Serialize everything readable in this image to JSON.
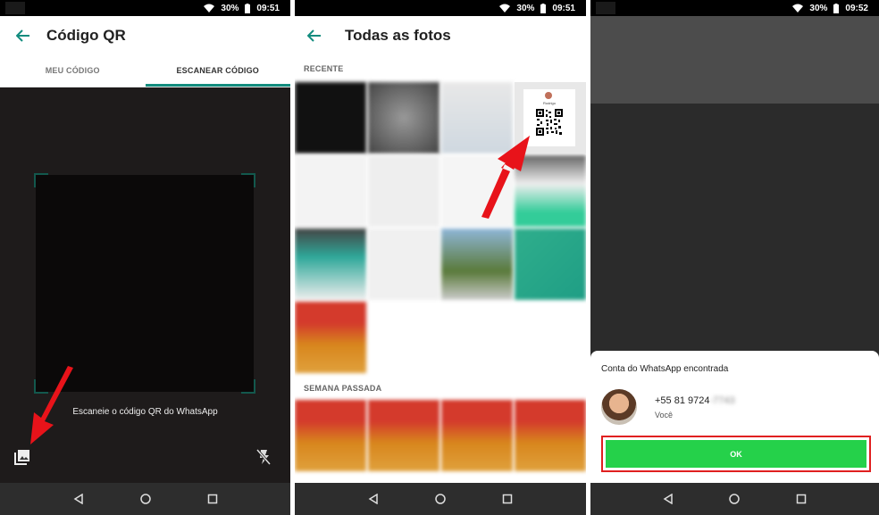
{
  "status": {
    "battery": "30%",
    "times": [
      "09:51",
      "09:51",
      "09:52"
    ]
  },
  "panel1": {
    "title": "Código QR",
    "tabs": [
      "MEU CÓDIGO",
      "ESCANEAR CÓDIGO"
    ],
    "active_tab": 1,
    "hint": "Escaneie o código QR do WhatsApp"
  },
  "panel2": {
    "title": "Todas as fotos",
    "section_recent": "RECENTE",
    "section_last_week": "SEMANA PASSADA",
    "qr_name": "Rodrigo"
  },
  "panel3": {
    "sheet_title": "Conta do WhatsApp encontrada",
    "phone_visible": "+55 81 9724",
    "phone_hidden": "-7743",
    "you_label": "Você",
    "ok_label": "OK"
  },
  "colors": {
    "accent": "#128c7e",
    "ok_green": "#25d14a",
    "arrow_red": "#e8131a",
    "highlight": "#e02020"
  }
}
